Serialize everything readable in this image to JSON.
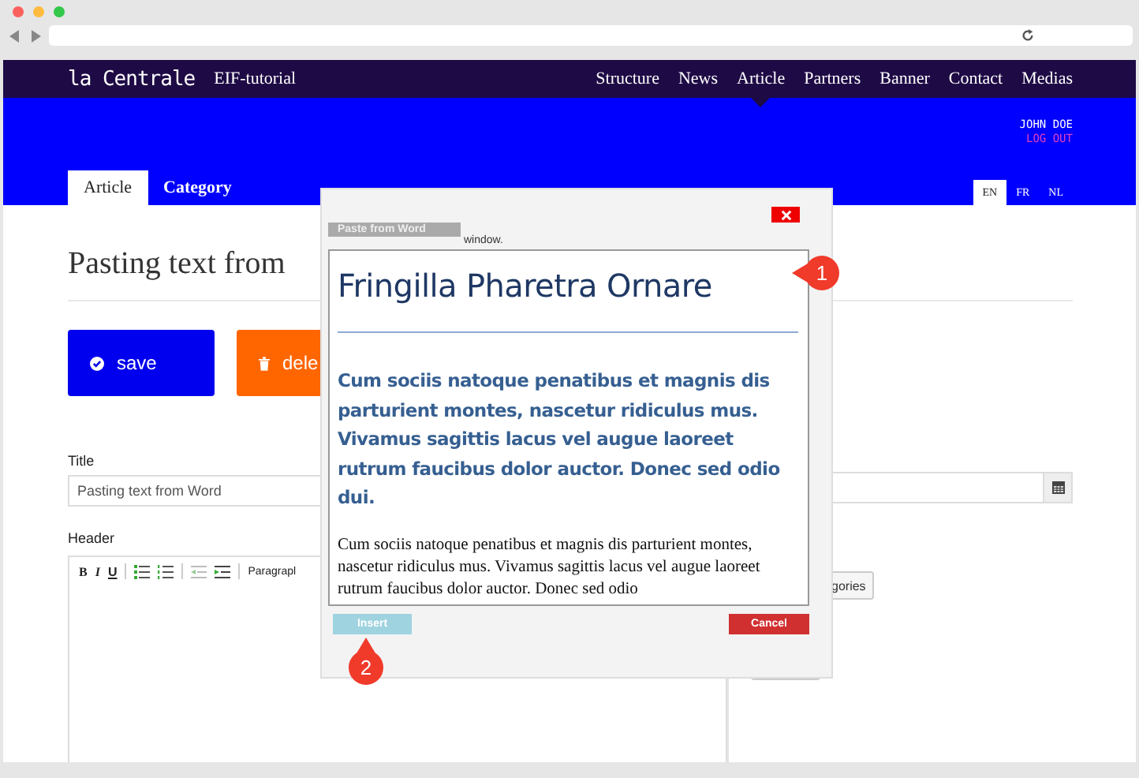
{
  "site": {
    "logo": "la Centrale",
    "subtitle": "EIF-tutorial",
    "menu": [
      {
        "label": "Structure",
        "selected": false
      },
      {
        "label": "News",
        "selected": false
      },
      {
        "label": "Article",
        "selected": true
      },
      {
        "label": "Partners",
        "selected": false
      },
      {
        "label": "Banner",
        "selected": false
      },
      {
        "label": "Contact",
        "selected": false
      },
      {
        "label": "Medias",
        "selected": false
      }
    ]
  },
  "user": {
    "name": "JOHN DOE",
    "logout": "LOG OUT"
  },
  "tabs": [
    {
      "label": "Article",
      "selected": true
    },
    {
      "label": "Category",
      "selected": false
    }
  ],
  "languages": [
    {
      "label": "EN",
      "selected": true
    },
    {
      "label": "FR",
      "selected": false
    },
    {
      "label": "NL",
      "selected": false
    }
  ],
  "page_title": "Pasting text from",
  "actions": [
    {
      "label": "save",
      "kind": "save"
    },
    {
      "label": "dele",
      "kind": "delete"
    }
  ],
  "form": {
    "title_label": "Title",
    "title_value": "Pasting text from Word",
    "header_label": "Header",
    "toolbar": [
      {
        "kind": "bold",
        "label": "B"
      },
      {
        "kind": "italic",
        "label": "I"
      },
      {
        "kind": "underline",
        "label": "U"
      },
      {
        "kind": "bullets"
      },
      {
        "kind": "numbers"
      },
      {
        "kind": "outdent"
      },
      {
        "kind": "indent"
      },
      {
        "kind": "format",
        "label": "Paragrapl"
      }
    ],
    "categories_button": "gories"
  },
  "dialog": {
    "tab_label": "Paste from Word",
    "instruction": "window.",
    "heading": "Fringilla Pharetra Ornare",
    "bold_paragraph": "Cum sociis natoque penatibus et magnis dis parturient   montes, nascetur ridiculus mus. Vivamus sagittis lacus vel augue laoreet rutrum faucibus dolor auctor. Donec sed odio dui.",
    "paragraph": "Cum sociis natoque penatibus et magnis dis parturient montes, nascetur ridiculus mus. Vivamus sagittis lacus vel augue laoreet rutrum faucibus dolor auctor. Donec sed odio",
    "insert": "Insert",
    "cancel": "Cancel"
  },
  "callouts": [
    "1",
    "2"
  ]
}
